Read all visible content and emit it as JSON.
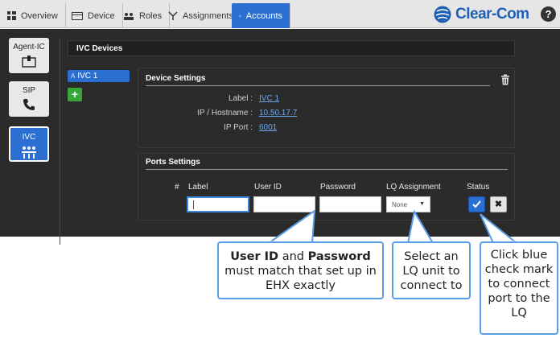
{
  "nav": {
    "tabs": [
      {
        "label": "Overview",
        "icon": "dashboard-icon"
      },
      {
        "label": "Device",
        "icon": "device-icon"
      },
      {
        "label": "Roles",
        "icon": "users-icon"
      },
      {
        "label": "Assignments",
        "icon": "assignments-icon"
      },
      {
        "label": "Accounts",
        "icon": "globe-icon",
        "active": true
      }
    ],
    "logo_text": "Clear-Com",
    "help_label": "?"
  },
  "sidebar": {
    "items": [
      {
        "label": "Agent-IC",
        "icon": "agent-ic-icon"
      },
      {
        "label": "SIP",
        "icon": "phone-icon"
      },
      {
        "label": "IVC",
        "icon": "ivc-icon",
        "active": true
      }
    ]
  },
  "main": {
    "header": "IVC Devices",
    "devices": [
      {
        "prefix": "A",
        "name": "IVC 1"
      }
    ],
    "add_label": "+",
    "device_settings": {
      "title": "Device Settings",
      "label_key": "Label :",
      "label_value": "IVC 1",
      "ip_key": "IP / Hostname :",
      "ip_value": "10.50.17.7",
      "port_key": "IP Port :",
      "port_value": "6001"
    },
    "ports_settings": {
      "title": "Ports Settings",
      "columns": [
        "#",
        "Label",
        "User ID",
        "Password",
        "LQ Assignment",
        "Status"
      ],
      "lq_selected": "None",
      "delete_label": "✖"
    }
  },
  "callouts": {
    "credentials": {
      "strong1": "User ID",
      "and": " and ",
      "strong2": "Password",
      "rest": "must match that set up in EHX exactly"
    },
    "lq": "Select an LQ unit to connect to",
    "check": "Click blue check mark to connect port to the LQ"
  },
  "colors": {
    "accent": "#2a6fd1",
    "panel": "#2b2b2b",
    "callout_border": "#5a9ee6",
    "add": "#3aa53a"
  }
}
